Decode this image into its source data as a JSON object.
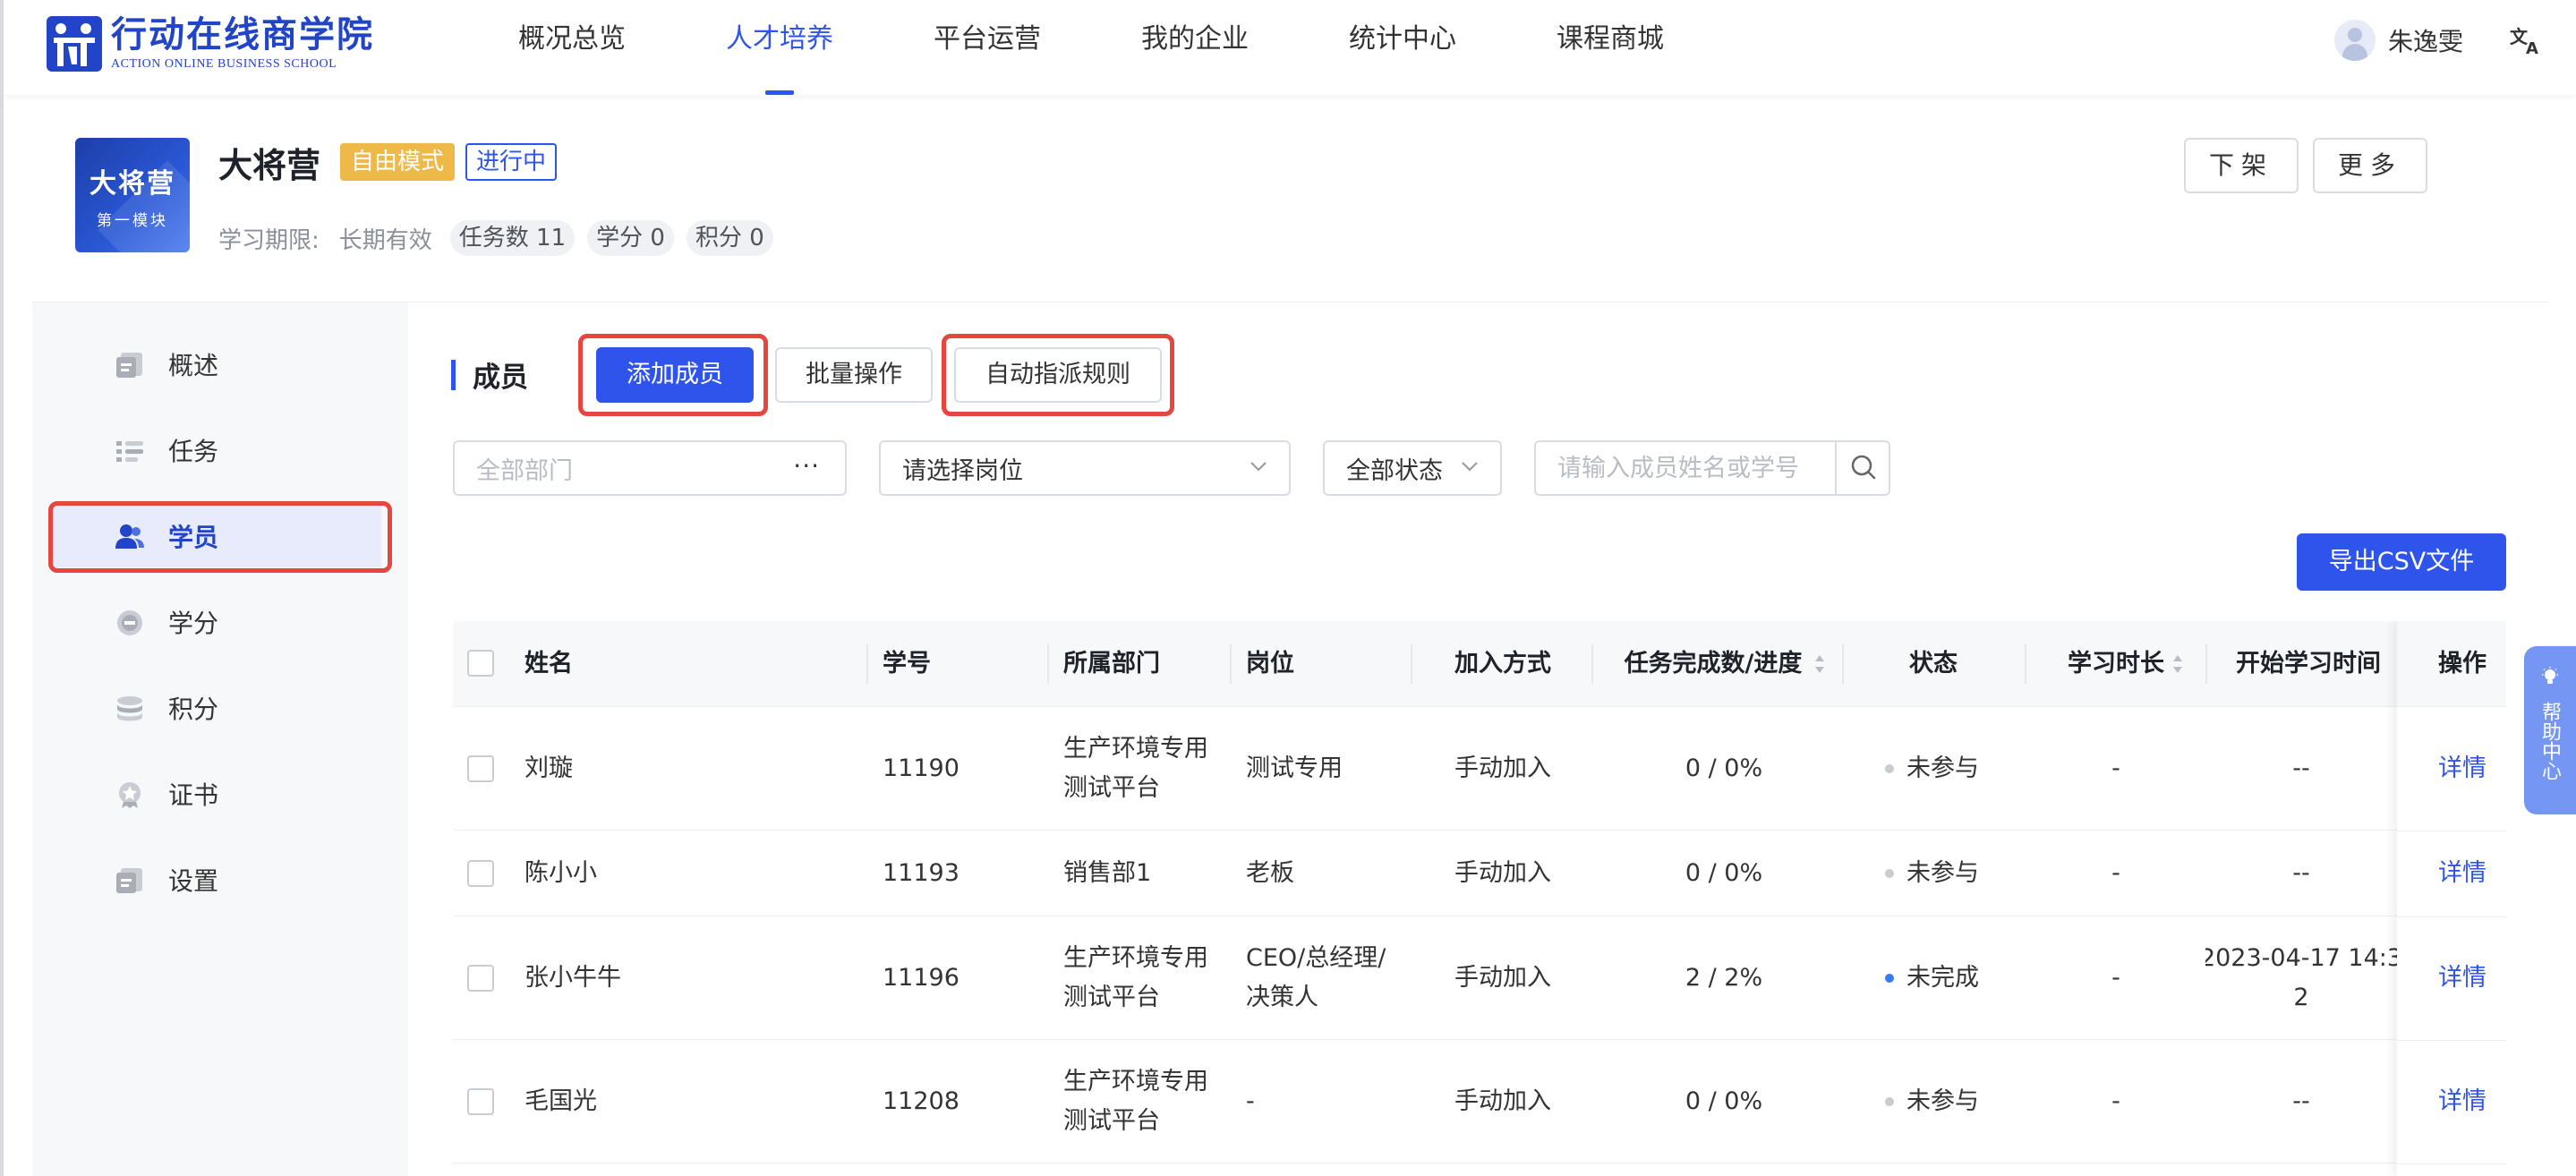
{
  "header": {
    "logo_cn": "行动在线商学院",
    "logo_en": "ACTION ONLINE BUSINESS SCHOOL",
    "nav": [
      "概况总览",
      "人才培养",
      "平台运营",
      "我的企业",
      "统计中心",
      "课程商城"
    ],
    "active_nav": "人才培养",
    "username": "朱逸雯"
  },
  "course": {
    "cover_title": "大将营",
    "cover_subtitle": "第一模块",
    "title": "大将营",
    "mode_tag": "自由模式",
    "status_tag": "进行中",
    "period_label": "学习期限:",
    "period_value": "长期有效",
    "chips": [
      "任务数 11",
      "学分 0",
      "积分 0"
    ],
    "offshelf_label": "下架",
    "more_label": "更多"
  },
  "sidebar": {
    "items": [
      {
        "label": "概述",
        "icon": "overview-icon"
      },
      {
        "label": "任务",
        "icon": "task-icon"
      },
      {
        "label": "学员",
        "icon": "users-icon"
      },
      {
        "label": "学分",
        "icon": "credit-icon"
      },
      {
        "label": "积分",
        "icon": "points-icon"
      },
      {
        "label": "证书",
        "icon": "certificate-icon"
      },
      {
        "label": "设置",
        "icon": "settings-icon"
      }
    ],
    "active": "学员"
  },
  "members": {
    "section_title": "成员",
    "add_label": "添加成员",
    "batch_label": "批量操作",
    "rule_label": "自动指派规则",
    "filters": {
      "dept_placeholder": "全部部门",
      "dept_more": "···",
      "post_placeholder": "请选择岗位",
      "status_value": "全部状态",
      "search_placeholder": "请输入成员姓名或学号"
    },
    "export_label": "导出CSV文件",
    "columns": [
      "姓名",
      "学号",
      "所属部门",
      "岗位",
      "加入方式",
      "任务完成数/进度",
      "状态",
      "学习时长",
      "开始学习时间",
      "操作"
    ],
    "rows": [
      {
        "name": "刘璇",
        "id": "11190",
        "dept": [
          "生产环境专用",
          "测试平台"
        ],
        "post": [
          "测试专用"
        ],
        "join": "手动加入",
        "progress": "0 / 0%",
        "status": "未参与",
        "duration": "-",
        "start": [
          "--"
        ],
        "action": "详情"
      },
      {
        "name": "陈小小",
        "id": "11193",
        "dept": [
          "销售部1"
        ],
        "post": [
          "老板"
        ],
        "join": "手动加入",
        "progress": "0 / 0%",
        "status": "未参与",
        "duration": "-",
        "start": [
          "--"
        ],
        "action": "详情"
      },
      {
        "name": "张小牛牛",
        "id": "11196",
        "dept": [
          "生产环境专用",
          "测试平台"
        ],
        "post": [
          "CEO/总经理/",
          "决策人"
        ],
        "join": "手动加入",
        "progress": "2 / 2%",
        "status": "未完成",
        "duration": "-",
        "start": [
          "2023-04-17 14:3",
          "2"
        ],
        "action": "详情"
      },
      {
        "name": "毛国光",
        "id": "11208",
        "dept": [
          "生产环境专用",
          "测试平台"
        ],
        "post": [
          "-"
        ],
        "join": "手动加入",
        "progress": "0 / 0%",
        "status": "未参与",
        "duration": "-",
        "start": [
          "--"
        ],
        "action": "详情"
      }
    ]
  },
  "help": {
    "label": "帮助中心"
  },
  "colors": {
    "primary": "#2f54eb",
    "highlight": "#e5463f",
    "mode_tag": "#efb94a",
    "status_not_joined": "#c8cbd0",
    "status_incomplete": "#3a7bf0"
  }
}
